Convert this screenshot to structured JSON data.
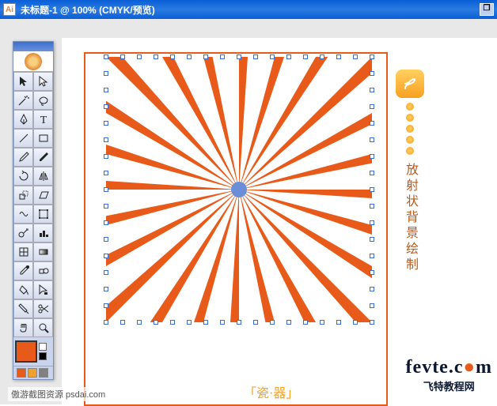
{
  "titlebar": {
    "icon_glyph": "Ai",
    "title": "未标题-1 @ 100% (CMYK/预览)",
    "restore": "❐"
  },
  "toolbox": {
    "tools": [
      "selection-tool",
      "direct-selection-tool",
      "magic-wand-tool",
      "lasso-tool",
      "pen-tool",
      "type-tool",
      "line-segment-tool",
      "rectangle-tool",
      "paintbrush-tool",
      "pencil-tool",
      "rotate-tool",
      "reflect-tool",
      "scale-tool",
      "shear-tool",
      "warp-tool",
      "free-transform-tool",
      "symbol-sprayer-tool",
      "column-graph-tool",
      "mesh-tool",
      "gradient-tool",
      "eyedropper-tool",
      "blend-tool",
      "live-paint-bucket-tool",
      "live-paint-selection-tool",
      "slice-tool",
      "scissors-tool",
      "hand-tool",
      "zoom-tool"
    ],
    "fill_color": "#e85a1a",
    "swatches": [
      "#e85a1a",
      "#f0a030",
      "#808080"
    ]
  },
  "side_label": {
    "text": "放射状背景绘制"
  },
  "bottom_tag": "「瓷·器」",
  "watermark": {
    "line1a": "fevte",
    "line1b": ".c",
    "line1c": "m",
    "line2": "飞特教程网"
  },
  "footer_watermark": "傲游截图资源 psdai.com"
}
